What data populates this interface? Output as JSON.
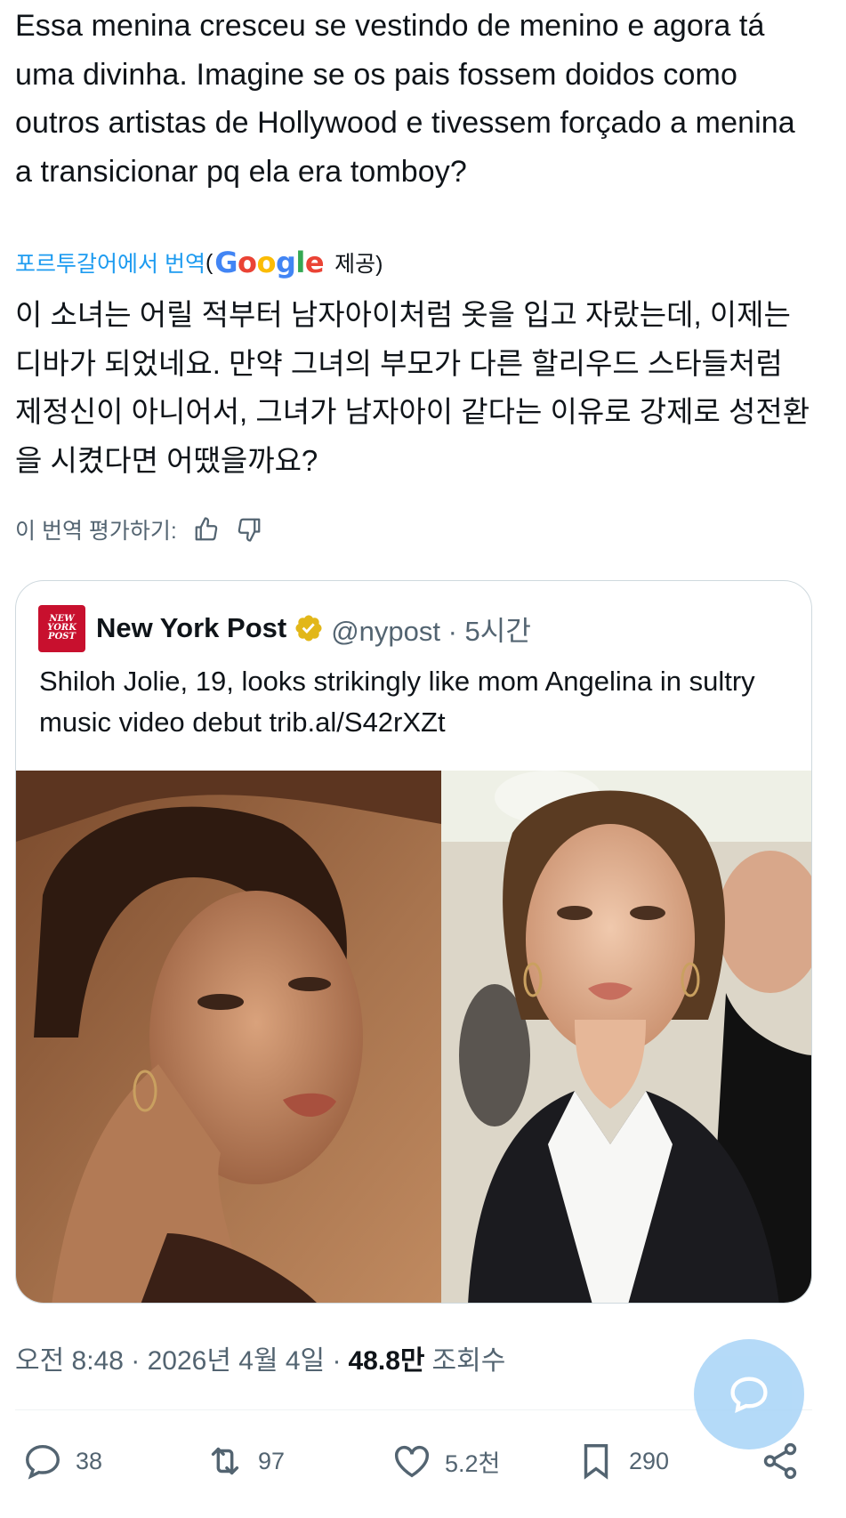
{
  "tweet": {
    "text": "Essa menina cresceu se vestindo de menino e agora tá uma divinha. Imagine se os pais fossem doidos como outros artistas de Hollywood e tivessem forçado a menina a transicionar pq ela era tomboy?",
    "translate_label": "포르투갈어에서 번역",
    "translate_open": "(",
    "google": [
      "G",
      "o",
      "o",
      "g",
      "l",
      "e"
    ],
    "translate_provided": "제공)",
    "translated_text": "이 소녀는 어릴 적부터 남자아이처럼 옷을 입고 자랐는데, 이제는 디바가 되었네요. 만약 그녀의 부모가 다른 할리우드 스타들처럼 제정신이 아니어서, 그녀가 남자아이 같다는 이유로 강제로 성전환을 시켰다면 어땠을까요?",
    "rate_label": "이 번역 평가하기:"
  },
  "quote": {
    "logo_text": [
      "NEW",
      "YORK",
      "POST"
    ],
    "name": "New York Post",
    "handle": "@nypost · 5시간",
    "text": "Shiloh Jolie, 19, looks strikingly like mom Angelina in sultry music video debut trib.al/S42rXZt"
  },
  "meta": {
    "timestamp": "오전 8:48 · 2026년 4월 4일 ·",
    "views_count": "48.8만",
    "views_label": "조회수"
  },
  "actions": {
    "replies": "38",
    "retweets": "97",
    "likes": "5.2천",
    "bookmarks": "290"
  },
  "colors": {
    "accent": "#1d9bf0",
    "secondary_text": "#536471",
    "verified_gold": "#e2b719",
    "nypost_red": "#c8102e",
    "fab": "#a8d4f7"
  }
}
